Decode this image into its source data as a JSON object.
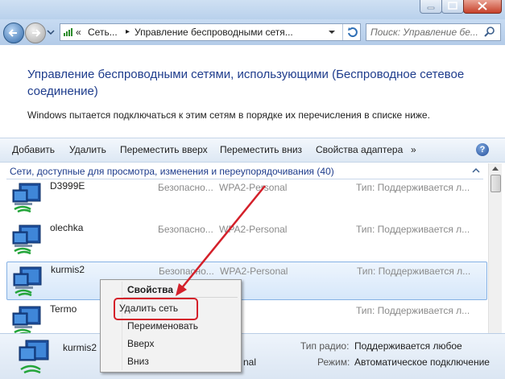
{
  "nav": {
    "address_prefix": "«",
    "crumb1": "Сеть...",
    "crumb_sep": "▸",
    "crumb2": "Управление беспроводными сетя...",
    "search_placeholder": "Поиск: Управление бе..."
  },
  "header": {
    "title": "Управление беспроводными сетями, использующими (Беспроводное сетевое соединение)",
    "description": "Windows пытается подключаться к этим сетям в порядке их перечисления в списке ниже."
  },
  "toolbar": {
    "add": "Добавить",
    "remove": "Удалить",
    "move_up": "Переместить вверх",
    "move_down": "Переместить вниз",
    "adapter_props": "Свойства адаптера",
    "more": "»",
    "help": "?"
  },
  "list": {
    "group_header": "Сети, доступные для просмотра, изменения и переупорядочивания (40)",
    "rows": [
      {
        "name": "D3999E",
        "security": "Безопасно...",
        "encryption": "WPA2-Personal",
        "type": "Тип: Поддерживается л..."
      },
      {
        "name": "olechka",
        "security": "Безопасно...",
        "encryption": "WPA2-Personal",
        "type": "Тип: Поддерживается л..."
      },
      {
        "name": "kurmis2",
        "security": "Безопасно...",
        "encryption": "WPA2-Personal",
        "type": "Тип: Поддерживается л..."
      },
      {
        "name": "Termo",
        "security": "",
        "encryption": "",
        "type": "Тип: Поддерживается л..."
      }
    ]
  },
  "details": {
    "name": "kurmis2",
    "encryption_partial": "nal",
    "radio_label": "Тип радио:",
    "radio_value": "Поддерживается любое",
    "mode_label": "Режим:",
    "mode_value": "Автоматическое подключение"
  },
  "context_menu": {
    "properties": "Свойства",
    "delete_network": "Удалить сеть",
    "rename": "Переименовать",
    "up": "Вверх",
    "down": "Вниз"
  },
  "colors": {
    "highlight_red": "#d4202a",
    "heading_blue": "#1e3c8c",
    "selection_border": "#85b1e4"
  }
}
